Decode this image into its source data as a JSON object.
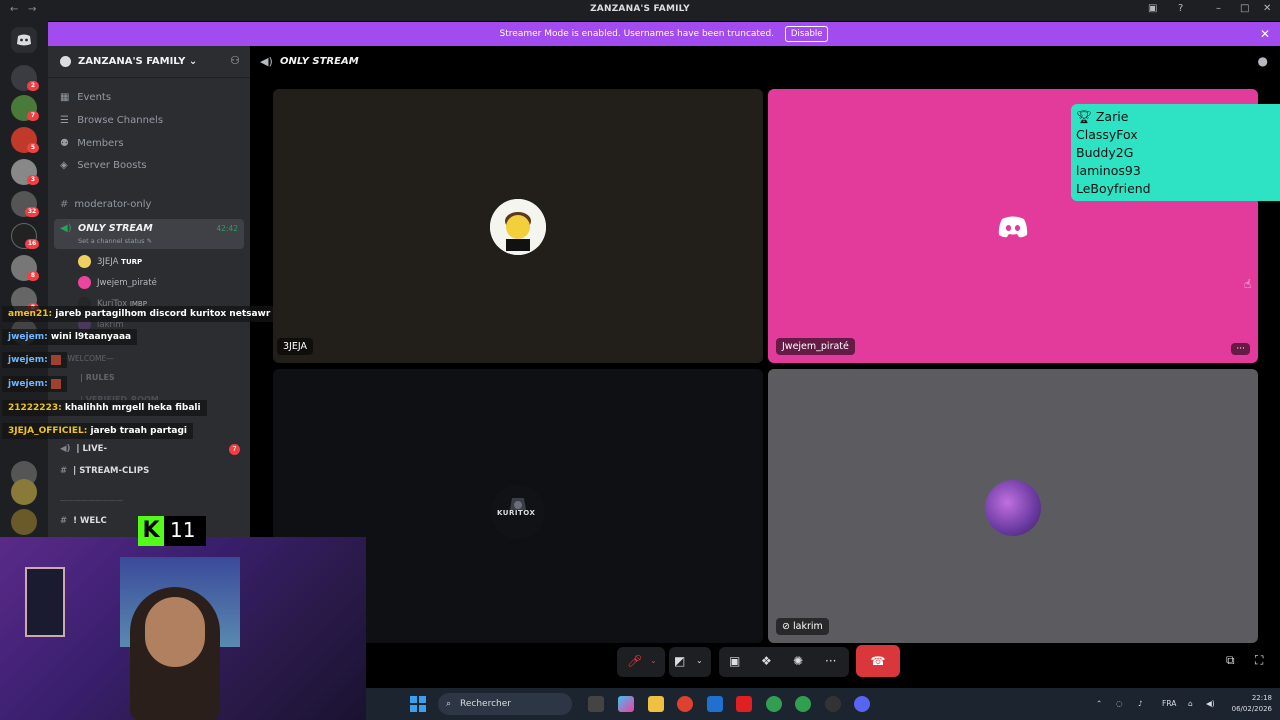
{
  "window": {
    "title": "ZANZANA'S FAMILY"
  },
  "banner": {
    "text": "Streamer Mode is enabled. Usernames have been truncated.",
    "disable_label": "Disable"
  },
  "server": {
    "name": "ZANZANA'S FAMILY",
    "menu": [
      {
        "label": "Events",
        "icon": "calendar-icon"
      },
      {
        "label": "Browse Channels",
        "icon": "browse-icon"
      },
      {
        "label": "Members",
        "icon": "members-icon"
      },
      {
        "label": "Server Boosts",
        "icon": "boost-icon"
      }
    ],
    "channels": {
      "moderator": "moderator-only",
      "voice_active": {
        "name": "ONLY STREAM",
        "time": "42:42",
        "status": "Set a channel status"
      },
      "voice_users": [
        "3JEJA",
        "Jwejem_piraté",
        "KuriTox",
        "lakrim"
      ],
      "user_tag_3jeja": "TURP",
      "user_tag_kuritox": "IMBP",
      "category_welcome": "—WELCOME—",
      "rules": "| RULES",
      "verified": "| VERIFIED_ROOM",
      "live": "| LIVE-",
      "live_badge": "7",
      "clips": "| STREAM-CLIPS",
      "category_divider": "—————————",
      "welc": "! WELC"
    }
  },
  "rail_badges": [
    "2",
    "7",
    "5",
    "3",
    "32",
    "16",
    "8",
    "8"
  ],
  "chat": [
    {
      "user": "amen21:",
      "text": "jareb partagilhom discord kuritox netsawr cv taw"
    },
    {
      "user": "jwejem:",
      "text": "wini l9taanyaaa"
    },
    {
      "user": "jwejem:",
      "text": ""
    },
    {
      "user": "jwejem:",
      "text": ""
    },
    {
      "user": "21222223:",
      "text": "khalihhh mrgell heka fibali"
    },
    {
      "user": "3JEJA_OFFICIEL:",
      "text": "jareb traah partagi"
    }
  ],
  "stage": {
    "channel_name": "ONLY STREAM",
    "tiles": [
      {
        "label": "3JEJA"
      },
      {
        "label": "Jwejem_piraté"
      },
      {
        "label": ""
      },
      {
        "label": "lakrim"
      }
    ],
    "kuritox_logo": "KURITOX",
    "overlay_list": [
      "Zarie",
      "ClassyFox",
      "Buddy2G",
      "laminos93",
      "LeBoyfriend"
    ]
  },
  "kick": {
    "viewer_count": "11"
  },
  "taskbar": {
    "search_placeholder": "Rechercher",
    "lang": "FRA",
    "time": "22:18",
    "date": "06/02/2026"
  }
}
